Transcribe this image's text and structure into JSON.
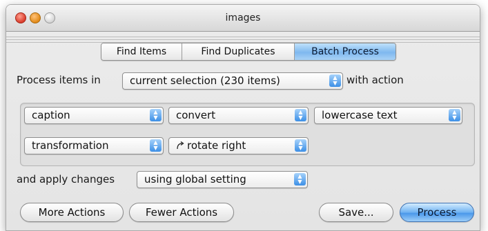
{
  "window": {
    "title": "images"
  },
  "tabs": [
    "Find Items",
    "Find Duplicates",
    "Batch Process"
  ],
  "active_tab": "Batch Process",
  "process": {
    "prefix_label": "Process items in",
    "scope_value": "current selection (230 items)",
    "suffix_label": "with action"
  },
  "actions": [
    {
      "target": "caption",
      "operation": "convert",
      "option": "lowercase text"
    },
    {
      "target": "transformation",
      "operation": "rotate right",
      "operation_icon": "rotate-arrow-icon"
    }
  ],
  "apply": {
    "label": "and apply changes",
    "value": "using global setting"
  },
  "buttons": {
    "more": "More Actions",
    "fewer": "Fewer Actions",
    "save": "Save...",
    "process": "Process"
  },
  "colors": {
    "accent": "#4b98ea",
    "close": "#d93b2a",
    "minimize": "#e28a18"
  }
}
